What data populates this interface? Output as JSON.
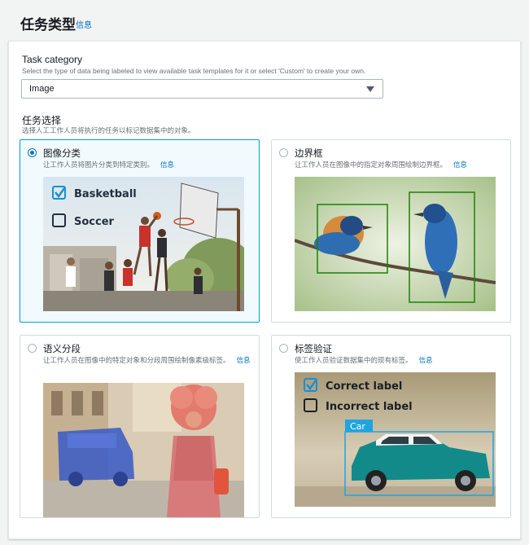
{
  "header": {
    "title": "任务类型",
    "info": "信息"
  },
  "task_category": {
    "label": "Task category",
    "description": "Select the type of data being labeled to view available task templates for it or select 'Custom' to create your own.",
    "selected": "Image"
  },
  "task_selection": {
    "label": "任务选择",
    "description": "选择人工工作人员将执行的任务以标记数据集中的对象。",
    "cards": [
      {
        "title": "图像分类",
        "description": "让工作人员将图片分类到特定类别。",
        "info": "信息",
        "selected": true,
        "labels": [
          "Basketball",
          "Soccer"
        ]
      },
      {
        "title": "边界框",
        "description": "让工作人员在图像中的指定对象周围绘制边界框。",
        "info": "信息",
        "selected": false
      },
      {
        "title": "语义分段",
        "description": "让工作人员在图像中的特定对象和分段周围绘制像素级标签。",
        "info": "信息",
        "selected": false
      },
      {
        "title": "标签验证",
        "description": "使工作人员验证数据集中的现有标签。",
        "info": "信息",
        "selected": false,
        "labels": [
          "Correct label",
          "Incorrect label"
        ],
        "box_tag": "Car"
      }
    ]
  },
  "colors": {
    "accent": "#0073bb",
    "selected_border": "#00a1c9",
    "bbox_green": "#1d8102",
    "bbox_blue": "#1fa4e0"
  }
}
